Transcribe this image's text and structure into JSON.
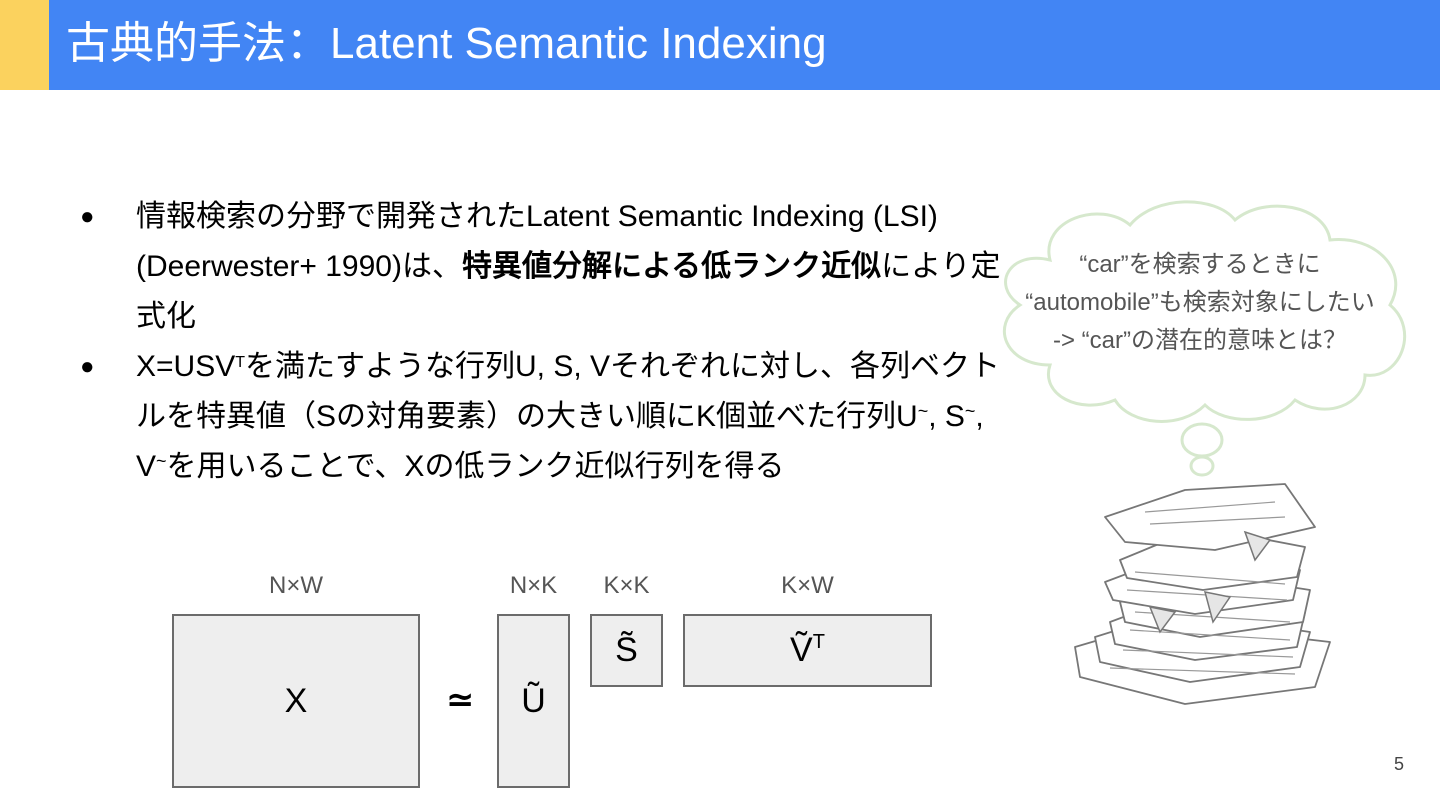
{
  "header": {
    "title": "古典的手法：Latent Semantic Indexing"
  },
  "bullets": [
    {
      "dot": "●",
      "pre": "情報検索の分野で開発されたLatent Semantic Indexing (LSI) (Deerwester+ 1990)は、",
      "bold": "特異値分解による低ランク近似",
      "post": "により定式化"
    },
    {
      "dot": "●",
      "pre": "X=USV",
      "sup": "T",
      "a": "を満たすような行列U, S, Vそれぞれに対し、各列ベクトルを特異値（Sの対角要素）の大きい順にK個並べた行列U",
      "t1": "~",
      "b": ", S",
      "t2": "~",
      "c": ", V",
      "t3": "~",
      "d": "を用いることで、Xの低ランク近似行列を得る"
    }
  ],
  "diagram": {
    "approx_symbol": "≃",
    "matrices": [
      {
        "label": "N×W",
        "symbol": "X"
      },
      {
        "label": "N×K",
        "symbol": "Ũ"
      },
      {
        "label": "K×K",
        "symbol": "S̃"
      },
      {
        "label": "K×W",
        "symbol": "Ṽ",
        "sup": "T"
      }
    ]
  },
  "thought": {
    "lines": [
      "“car”を検索するときに",
      "“automobile”も検索対象にしたい",
      "-> “car”の潜在的意味とは？"
    ]
  },
  "page_number": "5",
  "colors": {
    "title_bar": "#4285f4",
    "title_accent": "#fbd25e",
    "matrix_fill": "#eeeeee",
    "thought_outline": "#d6e8cd"
  }
}
